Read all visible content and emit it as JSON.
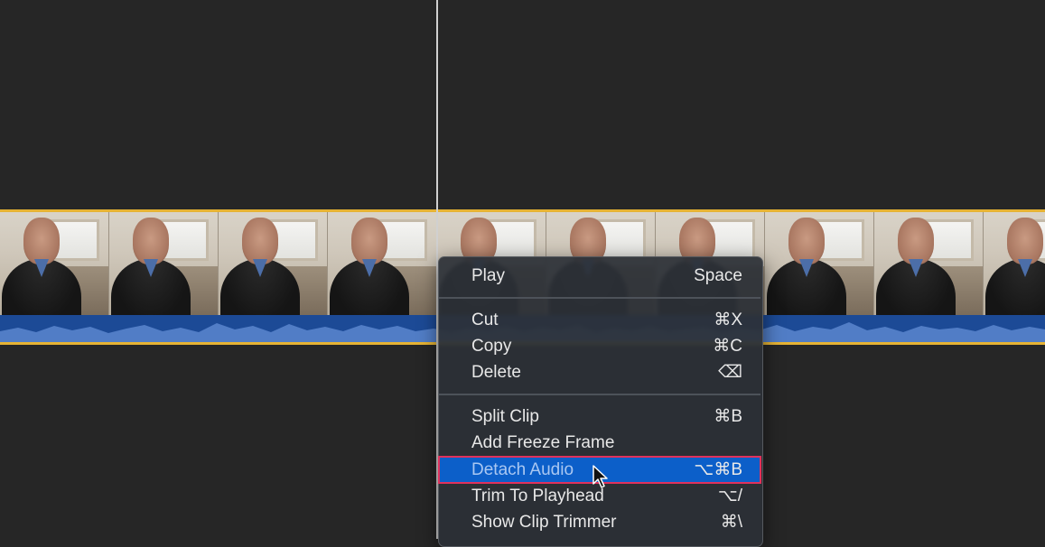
{
  "context_menu": {
    "items": [
      {
        "label": "Play",
        "shortcut": "Space"
      },
      {
        "label": "Cut",
        "shortcut": "⌘X"
      },
      {
        "label": "Copy",
        "shortcut": "⌘C"
      },
      {
        "label": "Delete",
        "shortcut": "⌫"
      },
      {
        "label": "Split Clip",
        "shortcut": "⌘B"
      },
      {
        "label": "Add Freeze Frame",
        "shortcut": ""
      },
      {
        "label": "Detach Audio",
        "shortcut": "⌥⌘B"
      },
      {
        "label": "Trim To Playhead",
        "shortcut": "⌥/"
      },
      {
        "label": "Show Clip Trimmer",
        "shortcut": "⌘\\"
      }
    ],
    "highlighted": "Detach Audio"
  },
  "colors": {
    "background": "#262626",
    "clip_border": "#e6b334",
    "audio_track": "#1c4a96",
    "menu_highlight": "#0c5fc9",
    "highlight_outline": "#e0325c"
  },
  "icons": {
    "cursor": "pointer-arrow-icon"
  }
}
